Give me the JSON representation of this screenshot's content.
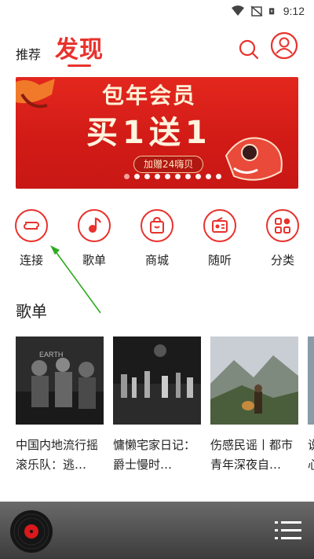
{
  "status_bar": {
    "time": "9:12"
  },
  "header": {
    "tab_recommend": "推荐",
    "tab_discover": "发现"
  },
  "banner": {
    "title_line1": "包年会员",
    "title_line2": "买1送1",
    "pill_text": "加赠24嗨贝",
    "dot_count": 10,
    "active_dot": 0
  },
  "categories": [
    {
      "label": "连接",
      "icon": "link-icon"
    },
    {
      "label": "歌单",
      "icon": "music-note-icon"
    },
    {
      "label": "商城",
      "icon": "shopping-bag-icon"
    },
    {
      "label": "随听",
      "icon": "radio-icon"
    },
    {
      "label": "分类",
      "icon": "grid-icon"
    }
  ],
  "playlist_section": {
    "title": "歌单",
    "cards": [
      {
        "title": "中国内地流行摇滚乐队：逃…"
      },
      {
        "title": "慵懒宅家日记：爵士慢时…"
      },
      {
        "title": "伤感民谣丨都市青年深夜自…"
      },
      {
        "title": "说心"
      }
    ]
  },
  "colors": {
    "accent": "#e8322d",
    "banner_bg": "#d11a16",
    "player_bg": "#4a4a4a",
    "arrow": "#2eaa1f"
  }
}
